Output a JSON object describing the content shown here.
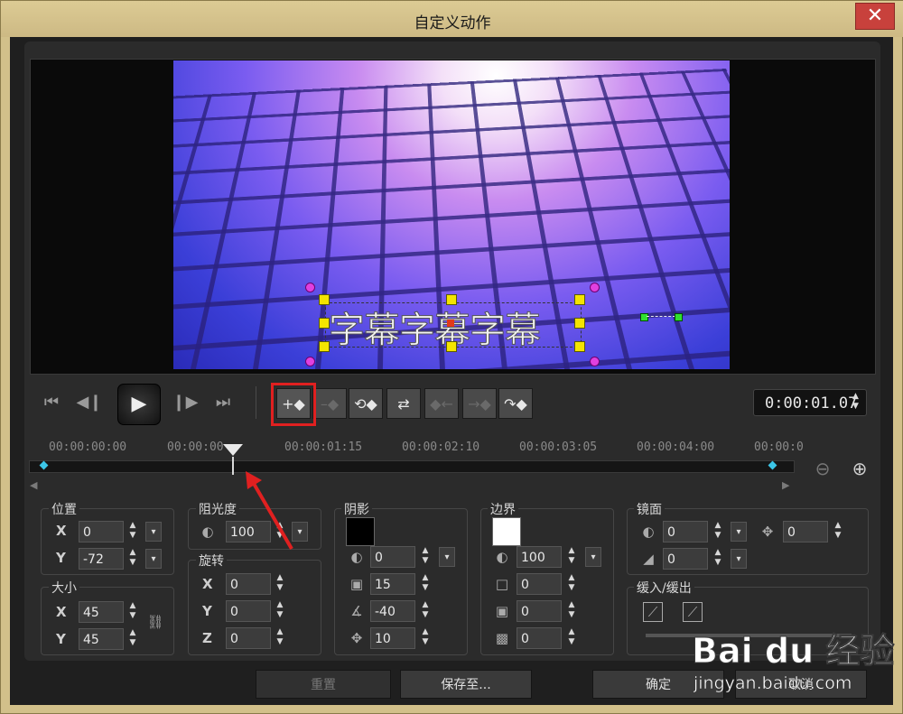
{
  "window": {
    "title": "自定义动作",
    "close_glyph": "✕"
  },
  "preview": {
    "subtitle_text": "字幕字幕字幕"
  },
  "transport": {
    "icons": [
      "skip-to-start-icon",
      "step-back-icon",
      "play-icon",
      "step-forward-icon",
      "skip-to-end-icon"
    ],
    "timecode": "0:00:01.07"
  },
  "keyframe_tools": {
    "add_glyph": "+◆",
    "icons": [
      "add-keyframe-icon",
      "remove-keyframe-icon",
      "reverse-keyframes-icon",
      "swap-keyframes-icon",
      "move-left-icon",
      "move-right-icon",
      "copy-keyframe-icon"
    ]
  },
  "timeline": {
    "ticks": [
      "00:00:00:00",
      "00:00:00",
      "00:00:01:15",
      "00:00:02:10",
      "00:00:03:05",
      "00:00:04:00",
      "00:00:0"
    ]
  },
  "position": {
    "label": "位置",
    "x_label": "X",
    "x": "0",
    "y_label": "Y",
    "y": "-72"
  },
  "size": {
    "label": "大小",
    "x_label": "X",
    "x": "45",
    "y_label": "Y",
    "y": "45"
  },
  "opacity": {
    "label": "阻光度",
    "value": "100"
  },
  "rotation": {
    "label": "旋转",
    "x_label": "X",
    "x": "0",
    "y_label": "Y",
    "y": "0",
    "z_label": "Z",
    "z": "0"
  },
  "shadow": {
    "label": "阴影",
    "color": "#000000",
    "opacity": "0",
    "blur": "15",
    "angle": "-40",
    "distance": "10"
  },
  "border": {
    "label": "边界",
    "color": "#ffffff",
    "opacity": "100",
    "width": "0",
    "v2": "0",
    "v3": "0"
  },
  "mirror": {
    "label": "镜面",
    "v1": "0",
    "v2": "0",
    "v3": "0"
  },
  "easing": {
    "label": "缓入/缓出"
  },
  "footer": {
    "reset": "重置",
    "save_to": "保存至...",
    "ok": "确定",
    "cancel": "取消"
  },
  "watermark": {
    "brand": "Bai du 经验",
    "url": "jingyan.baidu.com"
  },
  "colors": {
    "accent_red": "#e02020",
    "keyframe": "#3cc6e8"
  }
}
